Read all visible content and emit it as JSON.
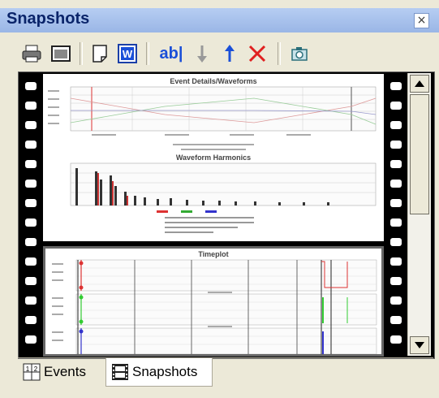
{
  "window": {
    "title": "Snapshots",
    "close_label": "×"
  },
  "toolbar": {
    "buttons": [
      {
        "icon": "print-icon"
      },
      {
        "icon": "preview-icon"
      },
      {
        "icon": "page-icon"
      },
      {
        "icon": "word-export-icon",
        "label": "W"
      },
      {
        "icon": "rename-icon",
        "label": "ab|"
      },
      {
        "icon": "move-down-icon"
      },
      {
        "icon": "move-up-icon"
      },
      {
        "icon": "delete-icon"
      },
      {
        "icon": "camera-icon"
      }
    ]
  },
  "snapshots": {
    "page1": {
      "title1": "Event Details/Waveforms",
      "title2": "Waveform Harmonics"
    },
    "page2": {
      "title": "Timeplot"
    }
  },
  "tabs": [
    {
      "label": "Events",
      "active": false,
      "icon": "events-tab-icon"
    },
    {
      "label": "Snapshots",
      "active": true,
      "icon": "snapshots-tab-icon"
    }
  ],
  "colors": {
    "titlebar": "#9ab6e6",
    "title_text": "#0a246a",
    "toolbar_blue": "#1a4fd8",
    "delete_red": "#e02020"
  }
}
